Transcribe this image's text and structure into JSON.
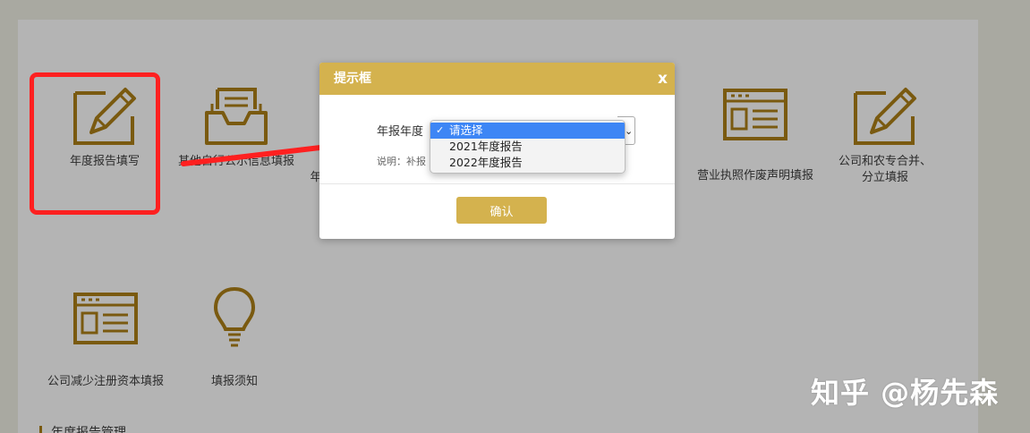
{
  "tiles": {
    "annual_report": "年度报告填写",
    "other_info": "其他自行公示信息填报",
    "partial_label_left": "年",
    "license_void": "营业执照作废声明填报",
    "merge_split": "公司和农专合并、分立填报",
    "capital_reduction": "公司减少注册资本填报",
    "notice": "填报须知"
  },
  "section": {
    "title": "年度报告管理"
  },
  "modal": {
    "title": "提示框",
    "close_label": "x",
    "field_label": "年报年度",
    "note_text": "说明：补报",
    "confirm_label": "确认"
  },
  "dropdown": {
    "options": [
      "请选择",
      "2021年度报告",
      "2022年度报告"
    ],
    "selected_index": 0,
    "check_mark": "✓",
    "arrow": "⌄"
  },
  "watermark": "知乎 @杨先森",
  "colors": {
    "accent_gold": "#d4b24e",
    "icon_brown": "#7a5a10",
    "highlight_red": "#ff2020",
    "select_blue": "#3d86f5"
  },
  "icons": {
    "annual_report": "edit-pencil-icon",
    "other_info": "inbox-document-icon",
    "license_void": "browser-window-icon",
    "merge_split": "edit-pencil-icon",
    "capital_reduction": "browser-window-icon",
    "notice": "lightbulb-icon"
  }
}
